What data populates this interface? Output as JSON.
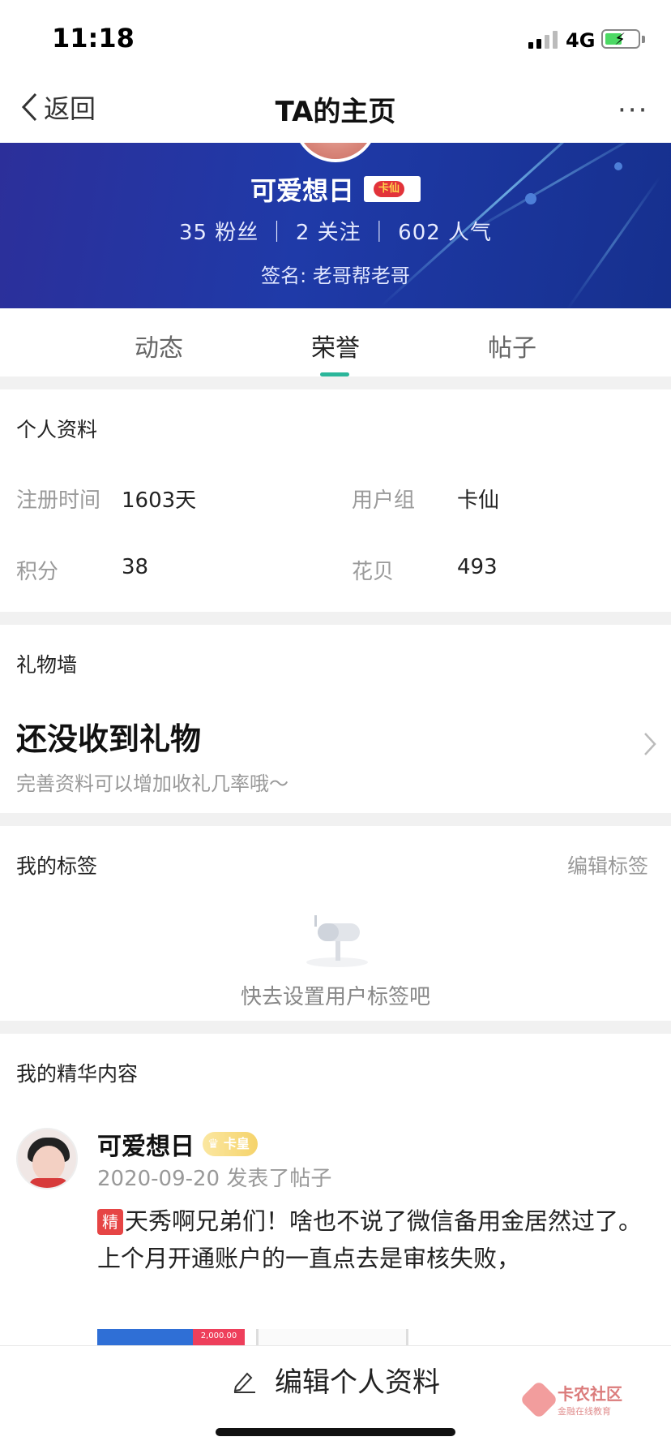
{
  "status_bar": {
    "time": "11:18",
    "network": "4G"
  },
  "nav": {
    "back_label": "返回",
    "title": "TA的主页",
    "more": "···"
  },
  "profile": {
    "username": "可爱想日",
    "badge": "卡仙",
    "stats": "35 粉丝 ｜ 2 关注 ｜ 602 人气",
    "signature": "签名: 老哥帮老哥"
  },
  "tabs": [
    {
      "label": "动态"
    },
    {
      "label": "荣誉"
    },
    {
      "label": "帖子"
    }
  ],
  "personal_info": {
    "title": "个人资料",
    "rows": [
      {
        "label": "注册时间",
        "value": "1603天",
        "label2": "用户组",
        "value2": "卡仙"
      },
      {
        "label": "积分",
        "value": "38",
        "label2": "花贝",
        "value2": "493"
      }
    ]
  },
  "gift_wall": {
    "title": "礼物墙",
    "empty_title": "还没收到礼物",
    "empty_hint": "完善资料可以增加收礼几率哦～"
  },
  "tags": {
    "title": "我的标签",
    "edit_label": "编辑标签",
    "empty_hint": "快去设置用户标签吧"
  },
  "featured": {
    "title": "我的精华内容",
    "post": {
      "author": "可爱想日",
      "author_badge": "卡皇",
      "meta": "2020-09-20 发表了帖子",
      "tag": "精",
      "text": "天秀啊兄弟们！啥也不说了微信备用金居然过了。上个月开通账户的一直点去是审核失败，",
      "thumb_amount": "2,000.00"
    }
  },
  "bottom": {
    "edit_profile": "编辑个人资料",
    "logo_name": "卡农社区",
    "logo_sub": "金融在线教育"
  }
}
